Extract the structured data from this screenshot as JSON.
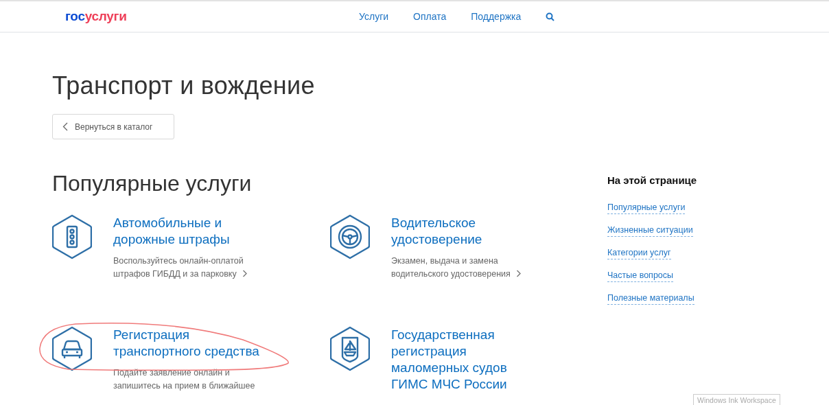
{
  "header": {
    "logo": {
      "part_1": "гос",
      "part_2": "услуги"
    },
    "nav": [
      "Услуги",
      "Оплата",
      "Поддержка"
    ]
  },
  "page_title": "Транспорт и вождение",
  "back_button": "Вернуться в каталог",
  "section_title": "Популярные услуги",
  "services": [
    {
      "title": "Автомобильные и дорожные штрафы",
      "description": "Воспользуйтесь онлайн-оплатой штрафов ГИБДД и за парковку"
    },
    {
      "title": "Водительское удостоверение",
      "description": "Экзамен, выдача и замена водительского удостоверения"
    },
    {
      "title": "Регистрация транспортного средства",
      "description": "Подайте заявление онлайн и запишитесь на прием в ближайшее"
    },
    {
      "title": "Государственная регистрация маломерных судов ГИМС МЧС России"
    }
  ],
  "on_this_page": {
    "title": "На этой странице",
    "links": [
      "Популярные услуги",
      "Жизненные ситуации",
      "Категории услуг",
      "Частые вопросы",
      "Полезные материалы"
    ]
  },
  "os_tooltip": "Windows Ink Workspace"
}
